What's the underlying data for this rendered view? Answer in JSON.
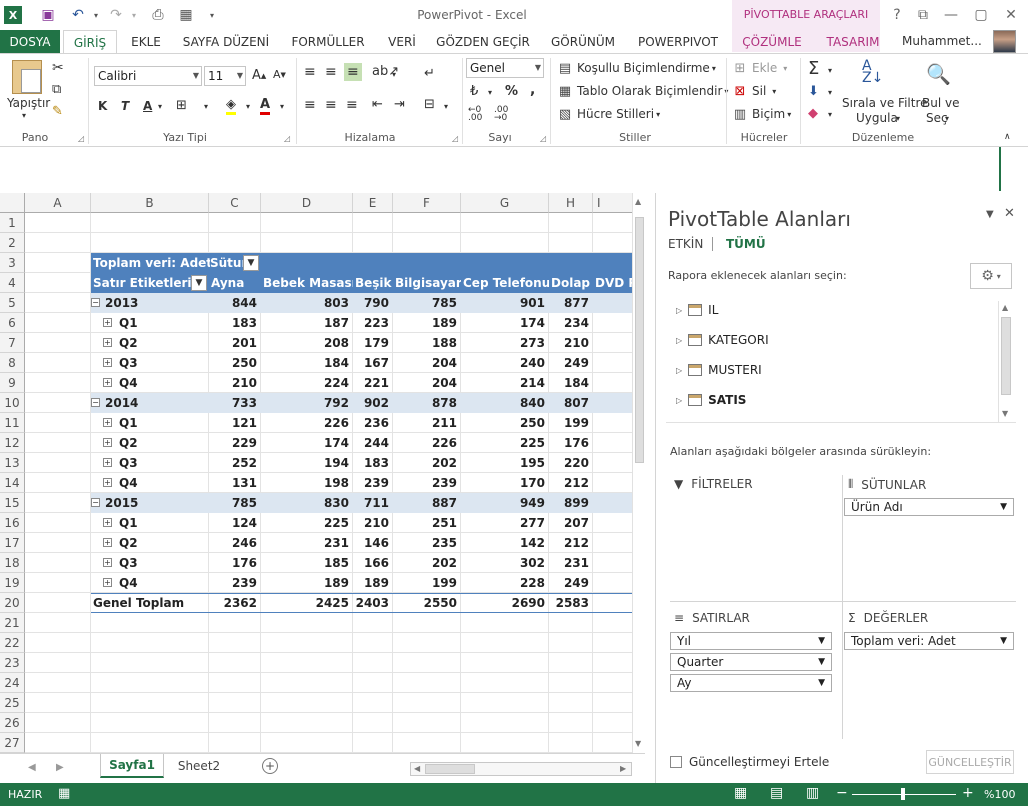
{
  "app_title": "PowerPivot - Excel",
  "contextual_group": "PİVOTTABLE ARAÇLARI",
  "tabs": {
    "file": "DOSYA",
    "items": [
      "GİRİŞ",
      "EKLE",
      "SAYFA DÜZENİ",
      "FORMÜLLER",
      "VERİ",
      "GÖZDEN GEÇİR",
      "GÖRÜNÜM",
      "POWERPIVOT",
      "ÇÖZÜMLE",
      "TASARIM"
    ]
  },
  "user": "Muhammet...",
  "ribbon": {
    "paste": "Yapıştır",
    "font_name": "Calibri",
    "font_size": "11",
    "bold": "K",
    "italic": "T",
    "underline": "A",
    "number_format": "Genel",
    "conditional": "Koşullu Biçimlendirme",
    "as_table": "Tablo Olarak Biçimlendir",
    "cell_styles": "Hücre Stilleri",
    "insert": "Ekle",
    "delete": "Sil",
    "format": "Biçim",
    "sort_filter_1": "Sırala ve Filtre",
    "sort_filter_2": "Uygula",
    "find_1": "Bul ve",
    "find_2": "Seç",
    "groups": [
      "Pano",
      "Yazı Tipi",
      "Hizalama",
      "Sayı",
      "Stiller",
      "Hücreler",
      "Düzenleme"
    ]
  },
  "grid": {
    "columns": [
      "A",
      "B",
      "C",
      "D",
      "E",
      "F",
      "G",
      "H",
      "I"
    ],
    "rows": [
      "1",
      "2",
      "3",
      "4",
      "5",
      "6",
      "7",
      "8",
      "9",
      "10",
      "11",
      "12",
      "13",
      "14",
      "15",
      "16",
      "17",
      "18",
      "19",
      "20",
      "21",
      "22",
      "23",
      "24",
      "25",
      "26",
      "27"
    ],
    "pivot_title": "Toplam veri: Adet",
    "pivot_col_label": "Sütun",
    "row_labels_header": "Satır Etiketleri",
    "col_headers": [
      "Ayna",
      "Bebek Masası",
      "Beşik",
      "Bilgisayar",
      "Cep Telefonu",
      "Dolap",
      "DVD P"
    ],
    "body": [
      {
        "label": "2013",
        "type": "year",
        "values": [
          "844",
          "803",
          "790",
          "785",
          "901",
          "877"
        ]
      },
      {
        "label": "Q1",
        "type": "q",
        "values": [
          "183",
          "187",
          "223",
          "189",
          "174",
          "234"
        ]
      },
      {
        "label": "Q2",
        "type": "q",
        "values": [
          "201",
          "208",
          "179",
          "188",
          "273",
          "210"
        ]
      },
      {
        "label": "Q3",
        "type": "q",
        "values": [
          "250",
          "184",
          "167",
          "204",
          "240",
          "249"
        ]
      },
      {
        "label": "Q4",
        "type": "q",
        "values": [
          "210",
          "224",
          "221",
          "204",
          "214",
          "184"
        ]
      },
      {
        "label": "2014",
        "type": "year",
        "values": [
          "733",
          "792",
          "902",
          "878",
          "840",
          "807"
        ]
      },
      {
        "label": "Q1",
        "type": "q",
        "values": [
          "121",
          "226",
          "236",
          "211",
          "250",
          "199"
        ]
      },
      {
        "label": "Q2",
        "type": "q",
        "values": [
          "229",
          "174",
          "244",
          "226",
          "225",
          "176"
        ]
      },
      {
        "label": "Q3",
        "type": "q",
        "values": [
          "252",
          "194",
          "183",
          "202",
          "195",
          "220"
        ]
      },
      {
        "label": "Q4",
        "type": "q",
        "values": [
          "131",
          "198",
          "239",
          "239",
          "170",
          "212"
        ]
      },
      {
        "label": "2015",
        "type": "year",
        "values": [
          "785",
          "830",
          "711",
          "887",
          "949",
          "899"
        ]
      },
      {
        "label": "Q1",
        "type": "q",
        "values": [
          "124",
          "225",
          "210",
          "251",
          "277",
          "207"
        ]
      },
      {
        "label": "Q2",
        "type": "q",
        "values": [
          "246",
          "231",
          "146",
          "235",
          "142",
          "212"
        ]
      },
      {
        "label": "Q3",
        "type": "q",
        "values": [
          "176",
          "185",
          "166",
          "202",
          "302",
          "231"
        ]
      },
      {
        "label": "Q4",
        "type": "q",
        "values": [
          "239",
          "189",
          "189",
          "199",
          "228",
          "249"
        ]
      }
    ],
    "grand_total_label": "Genel Toplam",
    "grand_total": [
      "2362",
      "2425",
      "2403",
      "2550",
      "2690",
      "2583"
    ]
  },
  "sheets": [
    "Sayfa1",
    "Sheet2"
  ],
  "status": {
    "ready": "HAZIR",
    "zoom": "%100"
  },
  "panel": {
    "title": "PivotTable Alanları",
    "tab_active": "ETKİN",
    "tab_all": "TÜMÜ",
    "choose_label": "Rapora eklenecek alanları seçin:",
    "fields": [
      "IL",
      "KATEGORI",
      "MUSTERI",
      "SATIS"
    ],
    "drag_label": "Alanları aşağıdaki bölgeler arasında sürükleyin:",
    "filters_title": "FİLTRELER",
    "columns_title": "SÜTUNLAR",
    "rows_title": "SATIRLAR",
    "values_title": "DEĞERLER",
    "columns_items": [
      "Ürün Adı"
    ],
    "rows_items": [
      "Yıl",
      "Quarter",
      "Ay"
    ],
    "values_items": [
      "Toplam veri: Adet"
    ],
    "defer_label": "Güncelleştirmeyi Ertele",
    "update_button": "GÜNCELLEŞTİR"
  },
  "colors": {
    "excel_green": "#217346",
    "pivot_header": "#4f81bd",
    "pivot_year": "#dce6f1",
    "context": "#b0307e"
  }
}
